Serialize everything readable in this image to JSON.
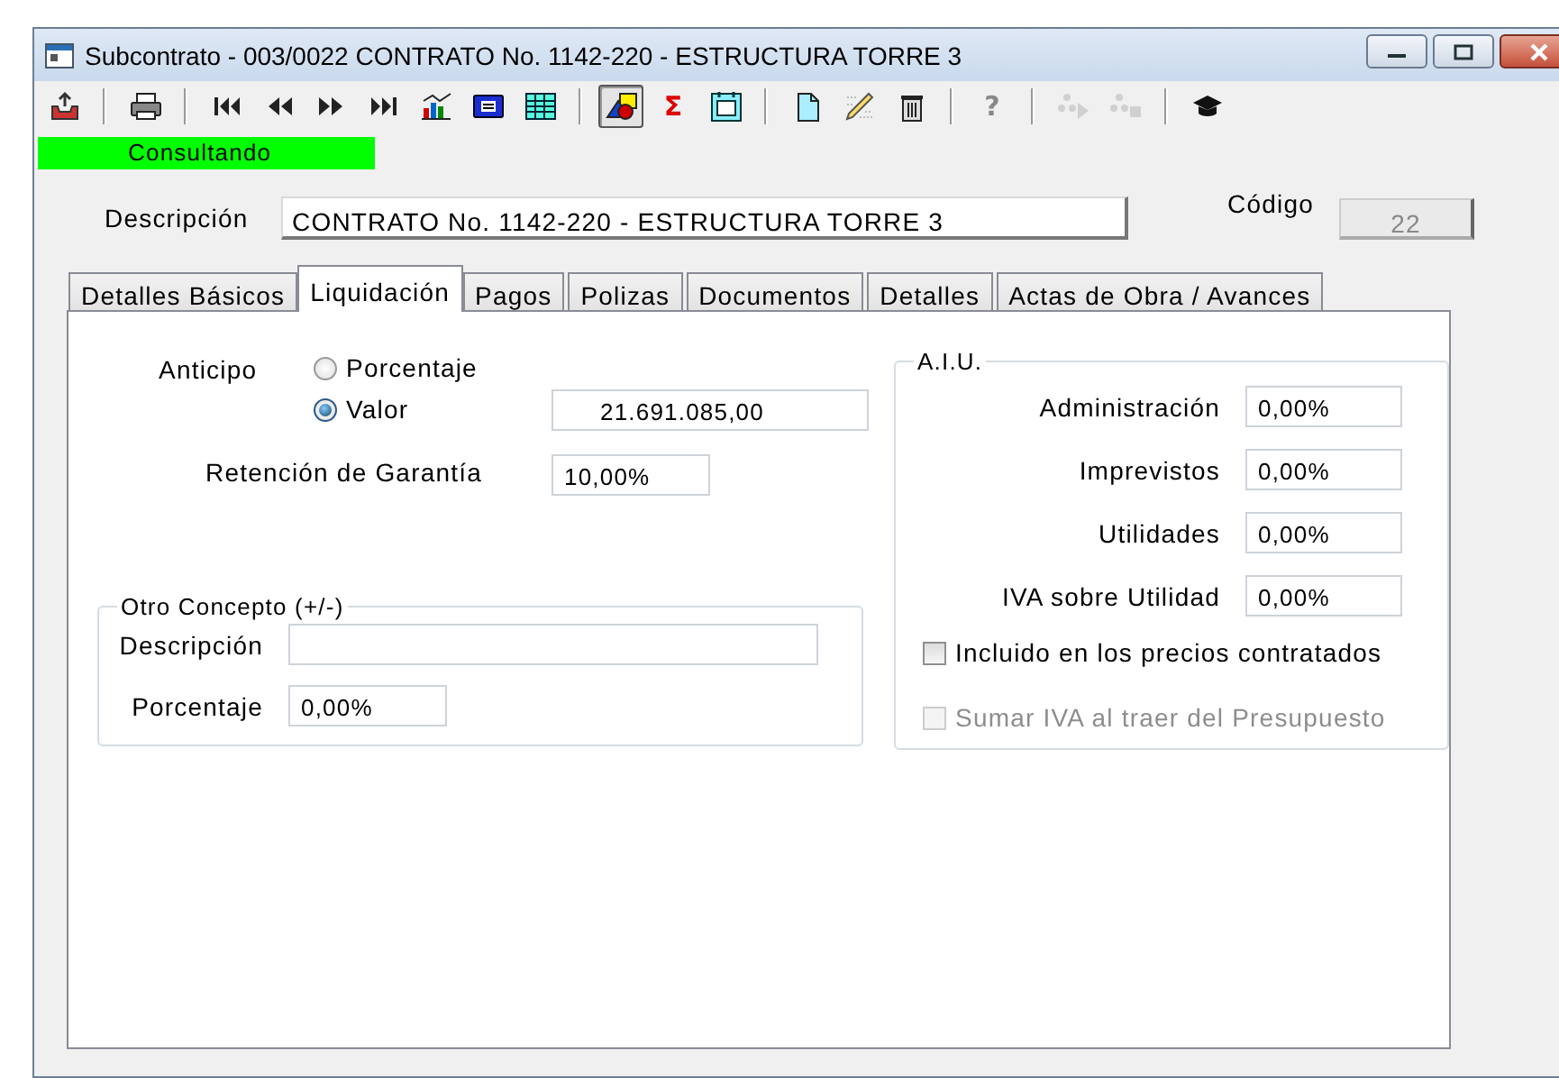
{
  "window": {
    "title": "Subcontrato - 003/0022 CONTRATO No. 1142-220 - ESTRUCTURA TORRE 3"
  },
  "toolbar": [
    {
      "kind": "icon",
      "disabled": false,
      "pressed": false
    },
    {
      "kind": "separator"
    },
    {
      "kind": "icon",
      "disabled": false,
      "pressed": false
    },
    {
      "kind": "separator"
    },
    {
      "kind": "icon",
      "disabled": false,
      "pressed": false
    },
    {
      "kind": "icon",
      "disabled": false,
      "pressed": false
    },
    {
      "kind": "icon",
      "disabled": false,
      "pressed": false
    },
    {
      "kind": "icon",
      "disabled": false,
      "pressed": false
    },
    {
      "kind": "icon",
      "disabled": false,
      "pressed": false
    },
    {
      "kind": "icon",
      "disabled": false,
      "pressed": false
    },
    {
      "kind": "icon",
      "disabled": false,
      "pressed": false
    },
    {
      "kind": "separator"
    },
    {
      "kind": "icon",
      "disabled": false,
      "pressed": true
    },
    {
      "kind": "glyph",
      "text": "Σ",
      "disabled": false,
      "pressed": false
    },
    {
      "kind": "icon",
      "disabled": false,
      "pressed": false
    },
    {
      "kind": "separator"
    },
    {
      "kind": "icon",
      "disabled": false,
      "pressed": false
    },
    {
      "kind": "icon",
      "disabled": false,
      "pressed": false
    },
    {
      "kind": "icon",
      "disabled": false,
      "pressed": false
    },
    {
      "kind": "separator"
    },
    {
      "kind": "glyph",
      "text": "?",
      "disabled": true,
      "pressed": false
    },
    {
      "kind": "separator"
    },
    {
      "kind": "icon",
      "disabled": true,
      "pressed": false
    },
    {
      "kind": "icon",
      "disabled": true,
      "pressed": false
    },
    {
      "kind": "separator"
    },
    {
      "kind": "icon",
      "disabled": false,
      "pressed": false
    }
  ],
  "status": "Consultando",
  "header": {
    "descripcion": {
      "label": "Descripción",
      "value": "CONTRATO No. 1142-220 - ESTRUCTURA TORRE 3"
    },
    "codigo": {
      "label": "Código",
      "value": "22",
      "disabled": true
    }
  },
  "tabs": [
    {
      "label": "Detalles Básicos",
      "selected": false
    },
    {
      "label": "Liquidación",
      "selected": true
    },
    {
      "label": "Pagos",
      "selected": false
    },
    {
      "label": "Polizas",
      "selected": false
    },
    {
      "label": "Documentos",
      "selected": false
    },
    {
      "label": "Detalles",
      "selected": false
    },
    {
      "label": "Actas de Obra / Avances",
      "selected": false
    }
  ],
  "anticipo": {
    "label": "Anticipo",
    "options": [
      {
        "label": "Porcentaje",
        "selected": false
      },
      {
        "label": "Valor",
        "selected": true
      }
    ],
    "value": "21.691.085,00"
  },
  "retencion": {
    "label": "Retención de Garantía",
    "value": "10,00%"
  },
  "otro_concepto": {
    "title": "Otro Concepto (+/-)",
    "fields": [
      {
        "label": "Descripción"
      },
      {
        "label": "Porcentaje",
        "value": "0,00%"
      }
    ]
  },
  "aiu": {
    "title": "A.I.U.",
    "fields": [
      {
        "label": "Administración",
        "value": "0,00%"
      },
      {
        "label": "Imprevistos",
        "value": "0,00%"
      },
      {
        "label": "Utilidades",
        "value": "0,00%"
      },
      {
        "label": "IVA sobre Utilidad",
        "value": "0,00%"
      }
    ],
    "checkboxes": [
      {
        "label": "Incluido en los precios contratados",
        "checked": false,
        "disabled": false
      },
      {
        "label": "Sumar IVA al traer del Presupuesto",
        "checked": false,
        "disabled": true
      }
    ]
  }
}
